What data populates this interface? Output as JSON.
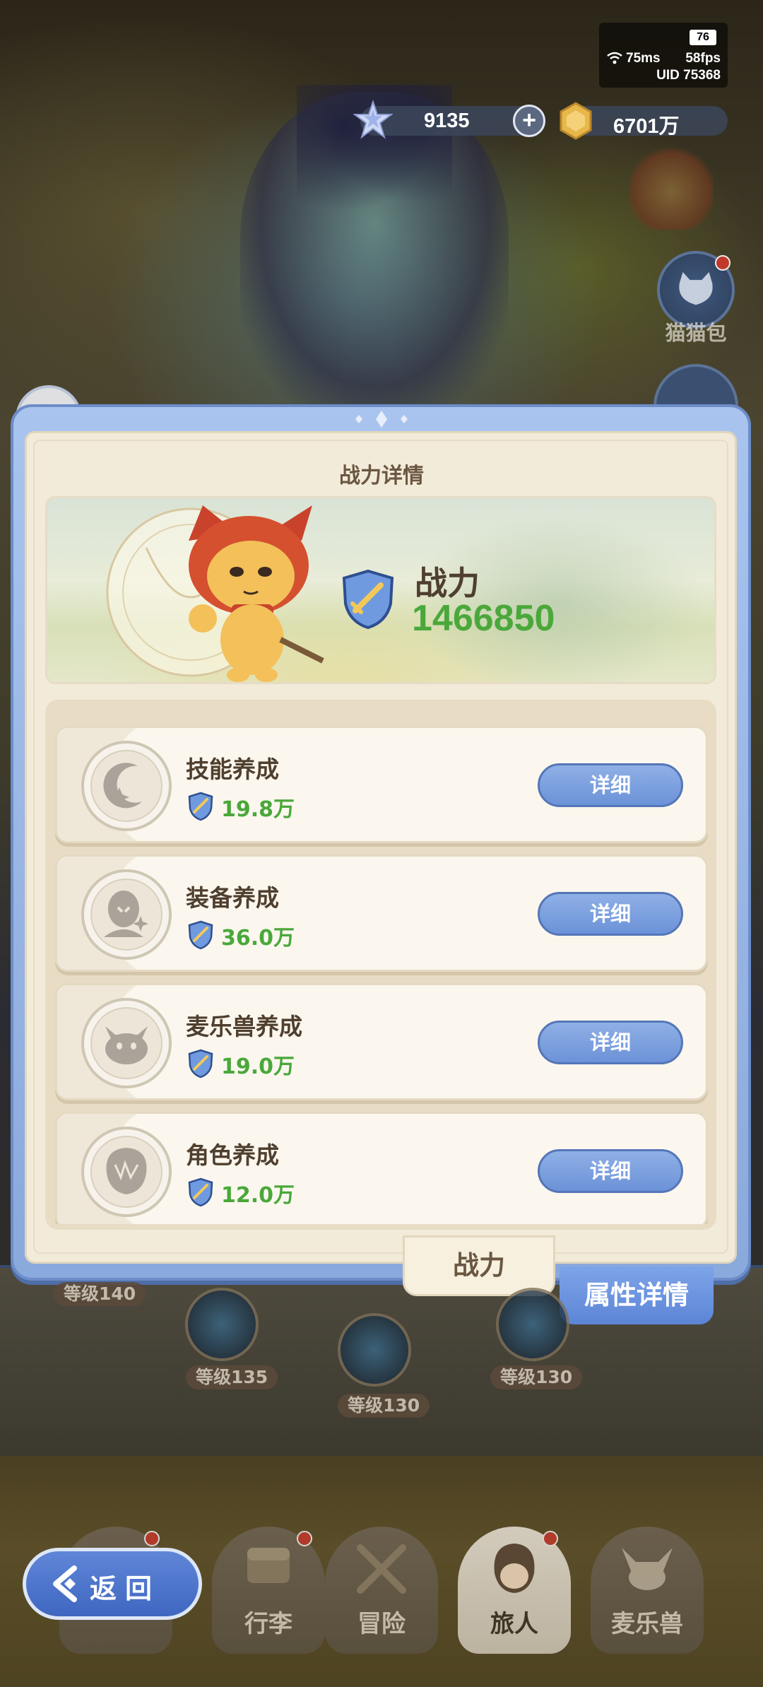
{
  "status": {
    "battery": "76",
    "ping": "75ms",
    "fps": "58fps",
    "uid": "UID  75368"
  },
  "currency": {
    "stars": "9135",
    "gold": "6701万"
  },
  "side": {
    "cat_bag_label": "猫猫包"
  },
  "panel": {
    "title": "战力详情",
    "power_label": "战力",
    "power_value": "1466850",
    "items": [
      {
        "title": "技能养成",
        "value": "19.8万",
        "button": "详细",
        "icon": "crescent-sparkle-icon"
      },
      {
        "title": "装备养成",
        "value": "36.0万",
        "button": "详细",
        "icon": "equipment-mask-icon"
      },
      {
        "title": "麦乐兽养成",
        "value": "19.0万",
        "button": "详细",
        "icon": "cat-face-icon"
      },
      {
        "title": "角色养成",
        "value": "12.0万",
        "button": "详细",
        "icon": "character-head-icon"
      }
    ]
  },
  "tabs": {
    "power": "战力",
    "attributes": "属性详情"
  },
  "background_levels": [
    "等级140",
    "等级135",
    "等级130",
    "等级130"
  ],
  "nav": {
    "back": "返回",
    "items": [
      "行李",
      "冒险",
      "旅人",
      "麦乐兽"
    ]
  },
  "colors": {
    "accent_blue": "#6c92d8",
    "power_green": "#4aa83b",
    "panel_cream": "#f3ebda",
    "text_brown": "#4f3f2e"
  }
}
